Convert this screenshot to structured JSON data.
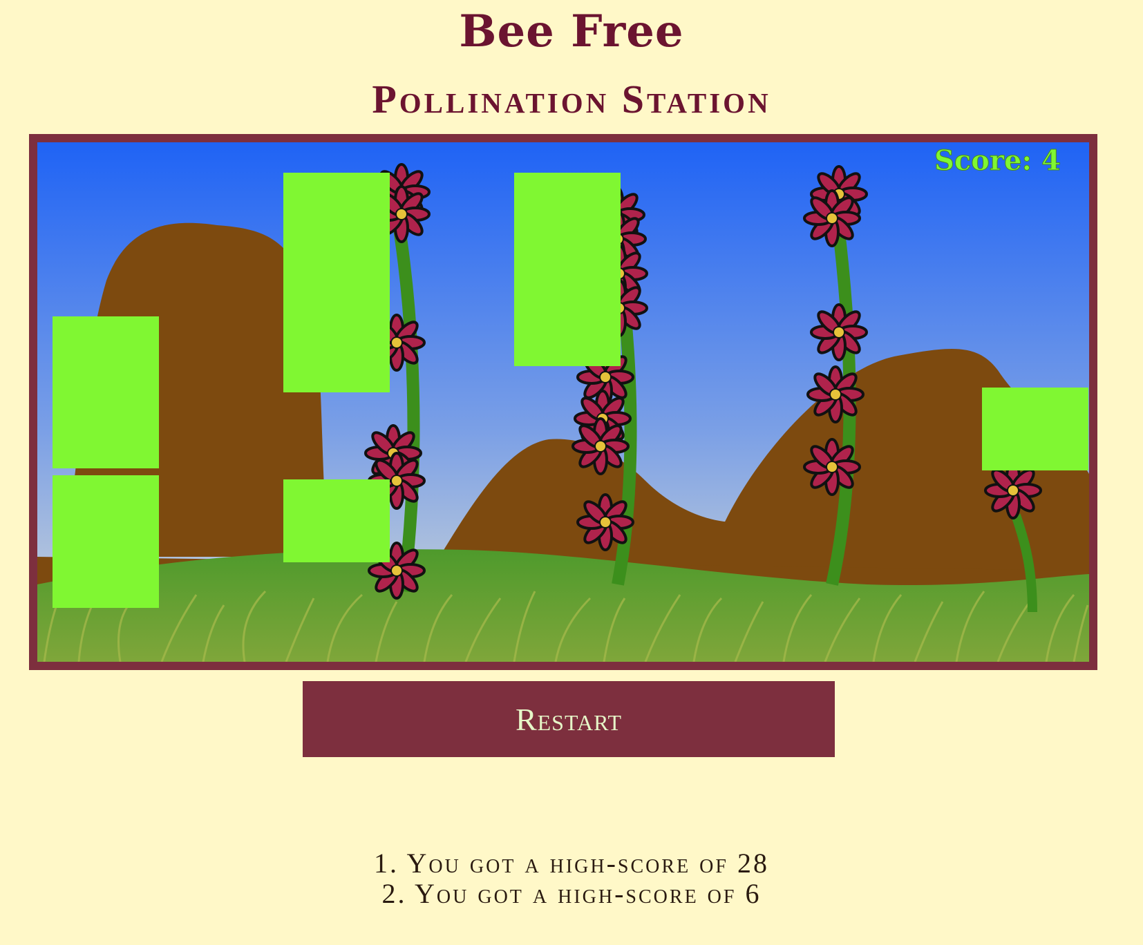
{
  "header": {
    "title": "Bee Free",
    "subtitle": "Pollination Station"
  },
  "game": {
    "score_text": "Score: 4",
    "colors": {
      "sky_top": "#1f63f5",
      "sky_bottom": "#c7d3de",
      "hill": "#7d4a0f",
      "grass": "#4f8f2a",
      "obstacle": "#80f732",
      "flower": "#b0234c",
      "stem": "#3c8f1c",
      "score": "#80f732",
      "frame": "#7d2f3e"
    }
  },
  "controls": {
    "restart_label": "Restart"
  },
  "high_scores": [
    "1. You got a high-score of 28",
    "2. You got a high-score of 6"
  ]
}
